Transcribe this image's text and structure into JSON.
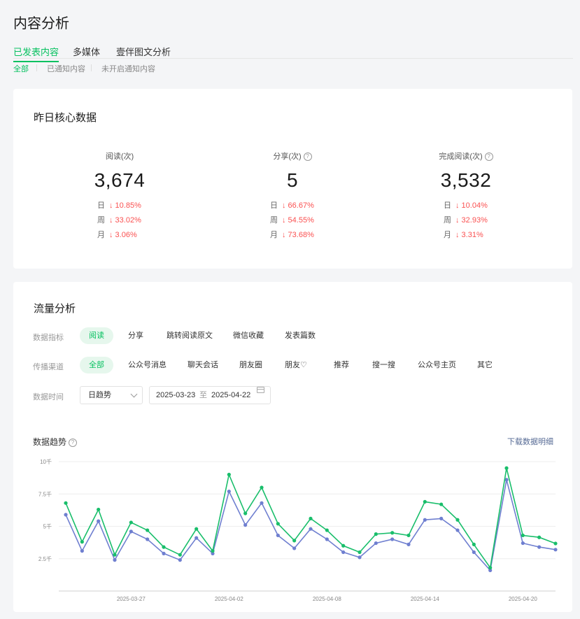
{
  "page": {
    "title": "内容分析"
  },
  "tabs": [
    {
      "label": "已发表内容",
      "active": true
    },
    {
      "label": "多媒体",
      "active": false
    },
    {
      "label": "壹伴图文分析",
      "active": false
    }
  ],
  "subtabs": [
    {
      "label": "全部",
      "active": true
    },
    {
      "label": "已通知内容",
      "active": false
    },
    {
      "label": "未开启通知内容",
      "active": false
    }
  ],
  "core": {
    "title": "昨日核心数据",
    "stats": [
      {
        "label": "阅读(次)",
        "help": false,
        "value": "3,674",
        "rows": [
          {
            "k": "日",
            "v": "↓ 10.85%"
          },
          {
            "k": "周",
            "v": "↓ 33.02%"
          },
          {
            "k": "月",
            "v": "↓ 3.06%"
          }
        ]
      },
      {
        "label": "分享(次)",
        "help": true,
        "value": "5",
        "rows": [
          {
            "k": "日",
            "v": "↓ 66.67%"
          },
          {
            "k": "周",
            "v": "↓ 54.55%"
          },
          {
            "k": "月",
            "v": "↓ 73.68%"
          }
        ]
      },
      {
        "label": "完成阅读(次)",
        "help": true,
        "value": "3,532",
        "rows": [
          {
            "k": "日",
            "v": "↓ 10.04%"
          },
          {
            "k": "周",
            "v": "↓ 32.93%"
          },
          {
            "k": "月",
            "v": "↓ 3.31%"
          }
        ]
      }
    ]
  },
  "traffic": {
    "title": "流量分析",
    "metric_label": "数据指标",
    "metrics": [
      {
        "label": "阅读",
        "active": true
      },
      {
        "label": "分享",
        "active": false
      },
      {
        "label": "跳转阅读原文",
        "active": false
      },
      {
        "label": "微信收藏",
        "active": false
      },
      {
        "label": "发表篇数",
        "active": false
      }
    ],
    "channel_label": "传播渠道",
    "channels": [
      {
        "label": "全部",
        "active": true
      },
      {
        "label": "公众号消息",
        "active": false
      },
      {
        "label": "聊天会话",
        "active": false
      },
      {
        "label": "朋友圈",
        "active": false
      },
      {
        "label": "朋友♡",
        "active": false
      },
      {
        "label": "推荐",
        "active": false
      },
      {
        "label": "搜一搜",
        "active": false
      },
      {
        "label": "公众号主页",
        "active": false
      },
      {
        "label": "其它",
        "active": false
      }
    ],
    "time_label": "数据时间",
    "granularity": "日趋势",
    "date_from": "2025-03-23",
    "date_sep": "至",
    "date_to": "2025-04-22",
    "trend_title": "数据趋势",
    "download": "下载数据明细"
  },
  "colors": {
    "accent": "#07c160",
    "series_green": "#19be6b",
    "series_blue": "#6f7fd0",
    "down": "#fa5151",
    "link": "#576b95"
  },
  "chart_data": {
    "type": "line",
    "ytick_labels": [
      "10千",
      "7.5千",
      "5千",
      "2.5千"
    ],
    "yticks": [
      10000,
      7500,
      5000,
      2500
    ],
    "ylim": [
      0,
      10000
    ],
    "xtick_labels": [
      "2025-03-27",
      "2025-04-02",
      "2025-04-08",
      "2025-04-14",
      "2025-04-20"
    ],
    "xtick_index": [
      4,
      10,
      16,
      22,
      28
    ],
    "x": [
      "03-23",
      "03-24",
      "03-25",
      "03-26",
      "03-27",
      "03-28",
      "03-29",
      "03-30",
      "03-31",
      "04-01",
      "04-02",
      "04-03",
      "04-04",
      "04-05",
      "04-06",
      "04-07",
      "04-08",
      "04-09",
      "04-10",
      "04-11",
      "04-12",
      "04-13",
      "04-14",
      "04-15",
      "04-16",
      "04-17",
      "04-18",
      "04-19",
      "04-20",
      "04-21",
      "04-22"
    ],
    "series": [
      {
        "color": "#19be6b",
        "values": [
          6800,
          3800,
          6300,
          2800,
          5300,
          4700,
          3400,
          2800,
          4800,
          3100,
          9000,
          6000,
          8000,
          5200,
          3900,
          5600,
          4700,
          3500,
          3000,
          4400,
          4500,
          4300,
          6900,
          6700,
          5500,
          3600,
          1800,
          9500,
          4300,
          4150,
          3674
        ]
      },
      {
        "color": "#6f7fd0",
        "values": [
          5900,
          3100,
          5400,
          2400,
          4600,
          4000,
          2900,
          2400,
          4100,
          2900,
          7700,
          5100,
          6800,
          4300,
          3300,
          4800,
          4000,
          3000,
          2600,
          3700,
          4000,
          3600,
          5500,
          5600,
          4700,
          3000,
          1600,
          8600,
          3700,
          3400,
          3200
        ]
      }
    ],
    "grid": true
  }
}
